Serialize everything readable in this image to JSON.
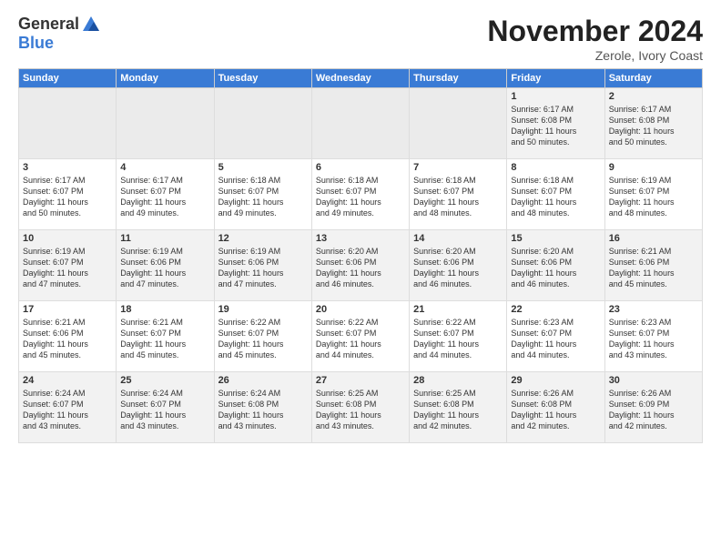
{
  "logo": {
    "general": "General",
    "blue": "Blue"
  },
  "title": "November 2024",
  "location": "Zerole, Ivory Coast",
  "days_of_week": [
    "Sunday",
    "Monday",
    "Tuesday",
    "Wednesday",
    "Thursday",
    "Friday",
    "Saturday"
  ],
  "weeks": [
    [
      {
        "day": "",
        "info": ""
      },
      {
        "day": "",
        "info": ""
      },
      {
        "day": "",
        "info": ""
      },
      {
        "day": "",
        "info": ""
      },
      {
        "day": "",
        "info": ""
      },
      {
        "day": "1",
        "info": "Sunrise: 6:17 AM\nSunset: 6:08 PM\nDaylight: 11 hours\nand 50 minutes."
      },
      {
        "day": "2",
        "info": "Sunrise: 6:17 AM\nSunset: 6:08 PM\nDaylight: 11 hours\nand 50 minutes."
      }
    ],
    [
      {
        "day": "3",
        "info": "Sunrise: 6:17 AM\nSunset: 6:07 PM\nDaylight: 11 hours\nand 50 minutes."
      },
      {
        "day": "4",
        "info": "Sunrise: 6:17 AM\nSunset: 6:07 PM\nDaylight: 11 hours\nand 49 minutes."
      },
      {
        "day": "5",
        "info": "Sunrise: 6:18 AM\nSunset: 6:07 PM\nDaylight: 11 hours\nand 49 minutes."
      },
      {
        "day": "6",
        "info": "Sunrise: 6:18 AM\nSunset: 6:07 PM\nDaylight: 11 hours\nand 49 minutes."
      },
      {
        "day": "7",
        "info": "Sunrise: 6:18 AM\nSunset: 6:07 PM\nDaylight: 11 hours\nand 48 minutes."
      },
      {
        "day": "8",
        "info": "Sunrise: 6:18 AM\nSunset: 6:07 PM\nDaylight: 11 hours\nand 48 minutes."
      },
      {
        "day": "9",
        "info": "Sunrise: 6:19 AM\nSunset: 6:07 PM\nDaylight: 11 hours\nand 48 minutes."
      }
    ],
    [
      {
        "day": "10",
        "info": "Sunrise: 6:19 AM\nSunset: 6:07 PM\nDaylight: 11 hours\nand 47 minutes."
      },
      {
        "day": "11",
        "info": "Sunrise: 6:19 AM\nSunset: 6:06 PM\nDaylight: 11 hours\nand 47 minutes."
      },
      {
        "day": "12",
        "info": "Sunrise: 6:19 AM\nSunset: 6:06 PM\nDaylight: 11 hours\nand 47 minutes."
      },
      {
        "day": "13",
        "info": "Sunrise: 6:20 AM\nSunset: 6:06 PM\nDaylight: 11 hours\nand 46 minutes."
      },
      {
        "day": "14",
        "info": "Sunrise: 6:20 AM\nSunset: 6:06 PM\nDaylight: 11 hours\nand 46 minutes."
      },
      {
        "day": "15",
        "info": "Sunrise: 6:20 AM\nSunset: 6:06 PM\nDaylight: 11 hours\nand 46 minutes."
      },
      {
        "day": "16",
        "info": "Sunrise: 6:21 AM\nSunset: 6:06 PM\nDaylight: 11 hours\nand 45 minutes."
      }
    ],
    [
      {
        "day": "17",
        "info": "Sunrise: 6:21 AM\nSunset: 6:06 PM\nDaylight: 11 hours\nand 45 minutes."
      },
      {
        "day": "18",
        "info": "Sunrise: 6:21 AM\nSunset: 6:07 PM\nDaylight: 11 hours\nand 45 minutes."
      },
      {
        "day": "19",
        "info": "Sunrise: 6:22 AM\nSunset: 6:07 PM\nDaylight: 11 hours\nand 45 minutes."
      },
      {
        "day": "20",
        "info": "Sunrise: 6:22 AM\nSunset: 6:07 PM\nDaylight: 11 hours\nand 44 minutes."
      },
      {
        "day": "21",
        "info": "Sunrise: 6:22 AM\nSunset: 6:07 PM\nDaylight: 11 hours\nand 44 minutes."
      },
      {
        "day": "22",
        "info": "Sunrise: 6:23 AM\nSunset: 6:07 PM\nDaylight: 11 hours\nand 44 minutes."
      },
      {
        "day": "23",
        "info": "Sunrise: 6:23 AM\nSunset: 6:07 PM\nDaylight: 11 hours\nand 43 minutes."
      }
    ],
    [
      {
        "day": "24",
        "info": "Sunrise: 6:24 AM\nSunset: 6:07 PM\nDaylight: 11 hours\nand 43 minutes."
      },
      {
        "day": "25",
        "info": "Sunrise: 6:24 AM\nSunset: 6:07 PM\nDaylight: 11 hours\nand 43 minutes."
      },
      {
        "day": "26",
        "info": "Sunrise: 6:24 AM\nSunset: 6:08 PM\nDaylight: 11 hours\nand 43 minutes."
      },
      {
        "day": "27",
        "info": "Sunrise: 6:25 AM\nSunset: 6:08 PM\nDaylight: 11 hours\nand 43 minutes."
      },
      {
        "day": "28",
        "info": "Sunrise: 6:25 AM\nSunset: 6:08 PM\nDaylight: 11 hours\nand 42 minutes."
      },
      {
        "day": "29",
        "info": "Sunrise: 6:26 AM\nSunset: 6:08 PM\nDaylight: 11 hours\nand 42 minutes."
      },
      {
        "day": "30",
        "info": "Sunrise: 6:26 AM\nSunset: 6:09 PM\nDaylight: 11 hours\nand 42 minutes."
      }
    ]
  ]
}
